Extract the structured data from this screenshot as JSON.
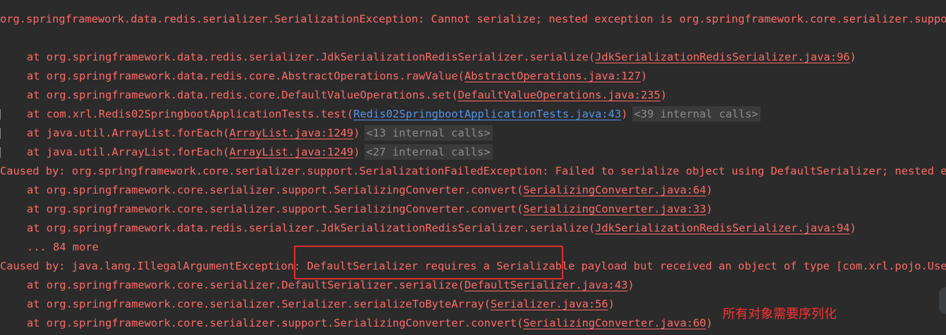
{
  "lines": {
    "l0": "org.springframework.data.redis.serializer.SerializationException: Cannot serialize; nested exception is org.springframework.core.serializer.support.S",
    "l1_pre": "at org.springframework.data.redis.serializer.JdkSerializationRedisSerializer.serialize(",
    "l1_link": "JdkSerializationRedisSerializer.java:96",
    "l1_post": ")",
    "l2_pre": "at org.springframework.data.redis.core.AbstractOperations.rawValue(",
    "l2_link": "AbstractOperations.java:127",
    "l2_post": ")",
    "l3_pre": "at org.springframework.data.redis.core.DefaultValueOperations.set(",
    "l3_link": "DefaultValueOperations.java:235",
    "l3_post": ")",
    "l4_pre": "at com.xrl.Redis02SpringbootApplicationTests.test(",
    "l4_link": "Redis02SpringbootApplicationTests.java:43",
    "l4_post": ")",
    "l4_internal": "<39 internal calls>",
    "l5_pre": "at java.util.ArrayList.forEach(",
    "l5_link": "ArrayList.java:1249",
    "l5_post": ")",
    "l5_internal": "<13 internal calls>",
    "l6_pre": "at java.util.ArrayList.forEach(",
    "l6_link": "ArrayList.java:1249",
    "l6_post": ")",
    "l6_internal": "<27 internal calls>",
    "l7": "Caused by: org.springframework.core.serializer.support.SerializationFailedException: Failed to serialize object using DefaultSerializer; nested excep",
    "l8_pre": "at org.springframework.core.serializer.support.SerializingConverter.convert(",
    "l8_link": "SerializingConverter.java:64",
    "l8_post": ")",
    "l9_pre": "at org.springframework.core.serializer.support.SerializingConverter.convert(",
    "l9_link": "SerializingConverter.java:33",
    "l9_post": ")",
    "l10_pre": "at org.springframework.data.redis.serializer.JdkSerializationRedisSerializer.serialize(",
    "l10_link": "JdkSerializationRedisSerializer.java:94",
    "l10_post": ")",
    "l11": "... 84 more",
    "l12": "Caused by: java.lang.IllegalArgumentException: DefaultSerializer requires a Serializable payload but received an object of type [com.xrl.pojo.User]",
    "l13_pre": "at org.springframework.core.serializer.DefaultSerializer.serialize(",
    "l13_link": "DefaultSerializer.java:43",
    "l13_post": ")",
    "l14_pre": "at org.springframework.core.serializer.Serializer.serializeToByteArray(",
    "l14_link": "Serializer.java:56",
    "l14_post": ")",
    "l15_pre": "at org.springframework.core.serializer.support.SerializingConverter.convert(",
    "l15_link": "SerializingConverter.java:60",
    "l15_post": ")"
  },
  "annotation_text": "所有对象需要序列化",
  "colors": {
    "background": "#2b2b2b",
    "error_text": "#ff6b68",
    "link_blue": "#5394ec",
    "highlight_box": "#e03030",
    "annotation": "#ff3030"
  }
}
